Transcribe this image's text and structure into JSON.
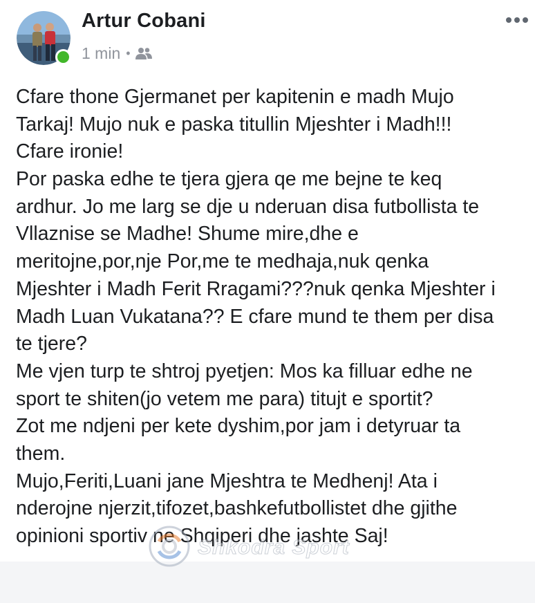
{
  "post": {
    "author": "Artur Cobani",
    "time": "1 min",
    "separator": "•",
    "audience_icon": "friends-icon",
    "more_icon": "more-options-icon",
    "body_lines": [
      "Cfare thone Gjermanet per kapitenin e madh Mujo",
      "Tarkaj! Mujo nuk e paska titullin Mjeshter i Madh!!!",
      "Cfare ironie!",
      "Por paska edhe te tjera gjera qe me bejne te keq",
      "ardhur. Jo me larg se dje u nderuan disa futbollista te",
      "Vllaznise se Madhe! Shume mire,dhe e",
      "meritojne,por,nje Por,me te medhaja,nuk qenka",
      "Mjeshter i Madh Ferit Rragami???nuk qenka Mjeshter i",
      "Madh Luan Vukatana?? E cfare mund te them per disa",
      "te tjere?",
      "Me vjen turp te shtroj pyetjen: Mos ka filluar edhe ne",
      "sport te shiten(jo vetem me para) titujt e sportit?",
      "Zot me ndjeni per kete dyshim,por jam i detyruar ta",
      "them.",
      "Mujo,Feriti,Luani jane Mjeshtra te Medhenj! Ata i",
      "nderojne njerzit,tifozet,bashkefutbollistet dhe gjithe",
      "opinioni sportiv ne Shqiperi dhe jashte Saj!"
    ]
  },
  "watermark": {
    "text": "Shkodra Sport"
  },
  "colors": {
    "name": "#1c1e21",
    "meta": "#90949c",
    "online": "#42b72a"
  }
}
